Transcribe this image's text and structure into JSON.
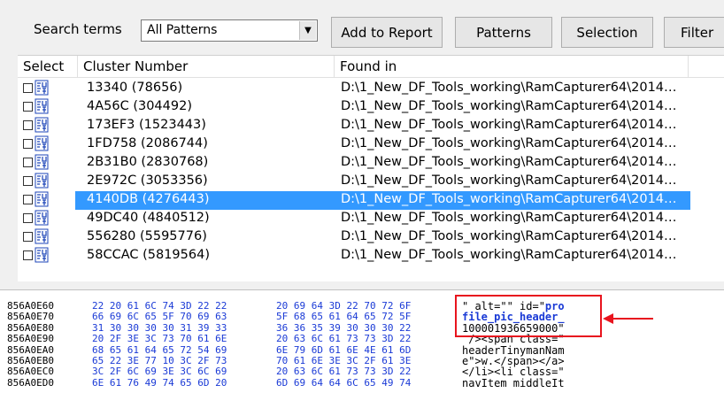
{
  "toolbar": {
    "search_label": "Search terms",
    "pattern_select": "All Patterns",
    "add_report": "Add to Report",
    "patterns": "Patterns",
    "selection": "Selection",
    "filter": "Filter"
  },
  "list": {
    "columns": [
      "Select",
      "Cluster Number",
      "Found in"
    ],
    "rows": [
      {
        "cluster": "13340 (78656)",
        "found": "D:\\1_New_DF_Tools_working\\RamCapturer64\\2014…"
      },
      {
        "cluster": "4A56C (304492)",
        "found": "D:\\1_New_DF_Tools_working\\RamCapturer64\\2014…"
      },
      {
        "cluster": "173EF3 (1523443)",
        "found": "D:\\1_New_DF_Tools_working\\RamCapturer64\\2014…"
      },
      {
        "cluster": "1FD758 (2086744)",
        "found": "D:\\1_New_DF_Tools_working\\RamCapturer64\\2014…"
      },
      {
        "cluster": "2B31B0 (2830768)",
        "found": "D:\\1_New_DF_Tools_working\\RamCapturer64\\2014…"
      },
      {
        "cluster": "2E972C (3053356)",
        "found": "D:\\1_New_DF_Tools_working\\RamCapturer64\\2014…"
      },
      {
        "cluster": "4140DB (4276443)",
        "found": "D:\\1_New_DF_Tools_working\\RamCapturer64\\2014…"
      },
      {
        "cluster": "49DC40 (4840512)",
        "found": "D:\\1_New_DF_Tools_working\\RamCapturer64\\2014…"
      },
      {
        "cluster": "556280 (5595776)",
        "found": "D:\\1_New_DF_Tools_working\\RamCapturer64\\2014…"
      },
      {
        "cluster": "58CCAC (5819564)",
        "found": "D:\\1_New_DF_Tools_working\\RamCapturer64\\2014…"
      }
    ],
    "selected_index": 6
  },
  "hex": {
    "rows": [
      {
        "addr": "856A0E60",
        "b1": "22 20 61 6C 74 3D 22 22",
        "b2": "20 69 64 3D 22 70 72 6F",
        "ascii_pre": "\" alt=\"\" id=\"",
        "ascii_hl": "pro"
      },
      {
        "addr": "856A0E70",
        "b1": "66 69 6C 65 5F 70 69 63",
        "b2": "5F 68 65 61 64 65 72 5F",
        "ascii_pre": "",
        "ascii_hl": "file_pic_header_"
      },
      {
        "addr": "856A0E80",
        "b1": "31 30 30 30 30 31 39 33",
        "b2": "36 36 35 39 30 30 30 22",
        "ascii_pre": "100001936659000\"",
        "ascii_hl": ""
      },
      {
        "addr": "856A0E90",
        "b1": "20 2F 3E 3C 73 70 61 6E",
        "b2": "20 63 6C 61 73 73 3D 22",
        "ascii_pre": " /><span class=\"",
        "ascii_hl": ""
      },
      {
        "addr": "856A0EA0",
        "b1": "68 65 61 64 65 72 54 69",
        "b2": "6E 79 6D 61 6E 4E 61 6D",
        "ascii_pre": "headerTinymanNam",
        "ascii_hl": ""
      },
      {
        "addr": "856A0EB0",
        "b1": "65 22 3E 77 10 3C 2F 73",
        "b2": "70 61 6E 3E 3C 2F 61 3E",
        "ascii_pre": "e\">w.</span></a>",
        "ascii_hl": ""
      },
      {
        "addr": "856A0EC0",
        "b1": "3C 2F 6C 69 3E 3C 6C 69",
        "b2": "20 63 6C 61 73 73 3D 22",
        "ascii_pre": "</li><li class=\"",
        "ascii_hl": ""
      },
      {
        "addr": "856A0ED0",
        "b1": "6E 61 76 49 74 65 6D 20",
        "b2": "6D 69 64 64 6C 65 49 74",
        "ascii_pre": "navItem middleIt",
        "ascii_hl": ""
      }
    ]
  },
  "colors": {
    "selection": "#3399ff",
    "callout": "#e8141e",
    "hex_blue": "#1a3ad6"
  }
}
